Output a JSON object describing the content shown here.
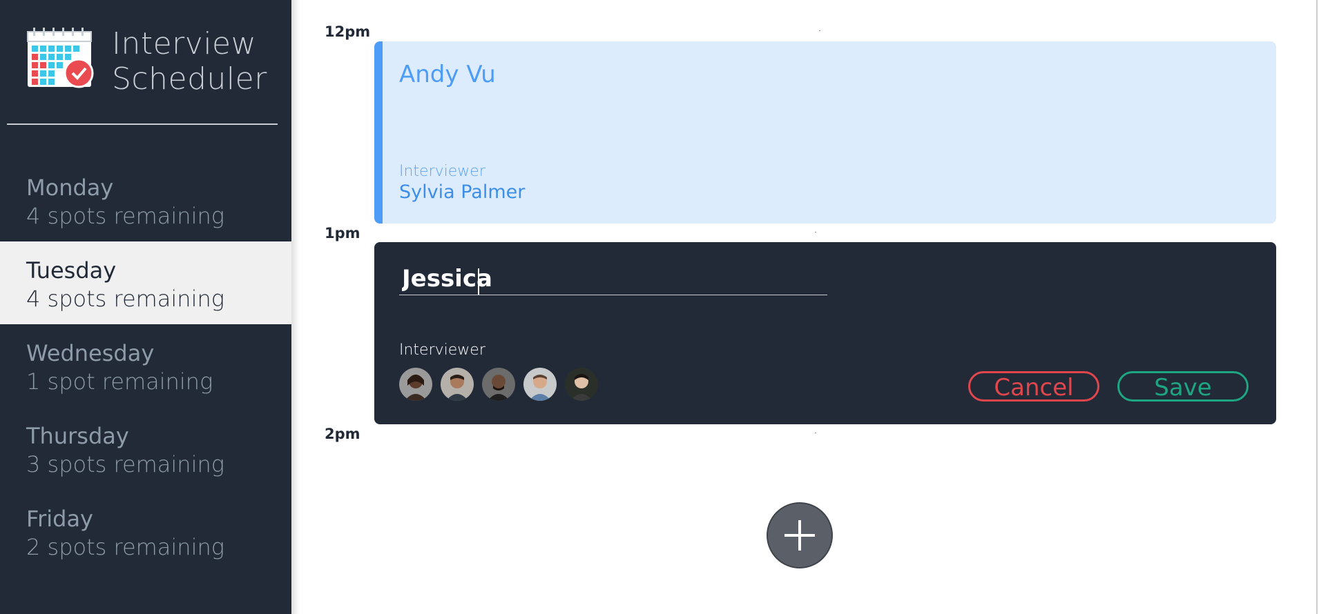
{
  "app": {
    "title_line1": "Interview",
    "title_line2": "Scheduler"
  },
  "sidebar": {
    "days": [
      {
        "name": "Monday",
        "spots": "4 spots remaining",
        "selected": false
      },
      {
        "name": "Tuesday",
        "spots": "4 spots remaining",
        "selected": true
      },
      {
        "name": "Wednesday",
        "spots": "1 spot remaining",
        "selected": false
      },
      {
        "name": "Thursday",
        "spots": "3 spots remaining",
        "selected": false
      },
      {
        "name": "Friday",
        "spots": "2 spots remaining",
        "selected": false
      }
    ]
  },
  "schedule": {
    "times": [
      "12pm",
      "1pm",
      "2pm"
    ],
    "booked": {
      "student": "Andy Vu",
      "interviewer_label": "Interviewer",
      "interviewer_name": "Sylvia Palmer"
    },
    "form": {
      "student_value": "Jessica",
      "interviewer_label": "Interviewer",
      "interviewers": [
        "interviewer-avatar-1",
        "interviewer-avatar-2",
        "interviewer-avatar-3",
        "interviewer-avatar-4",
        "interviewer-avatar-5"
      ],
      "cancel_label": "Cancel",
      "save_label": "Save"
    }
  },
  "icons": {
    "logo": "calendar-check-icon",
    "add": "plus-icon"
  },
  "colors": {
    "sidebar_bg": "#222a38",
    "booked_bg": "#ddecfd",
    "booked_accent": "#4d9cf6",
    "cancel": "#e0474c",
    "save": "#1ea582"
  }
}
